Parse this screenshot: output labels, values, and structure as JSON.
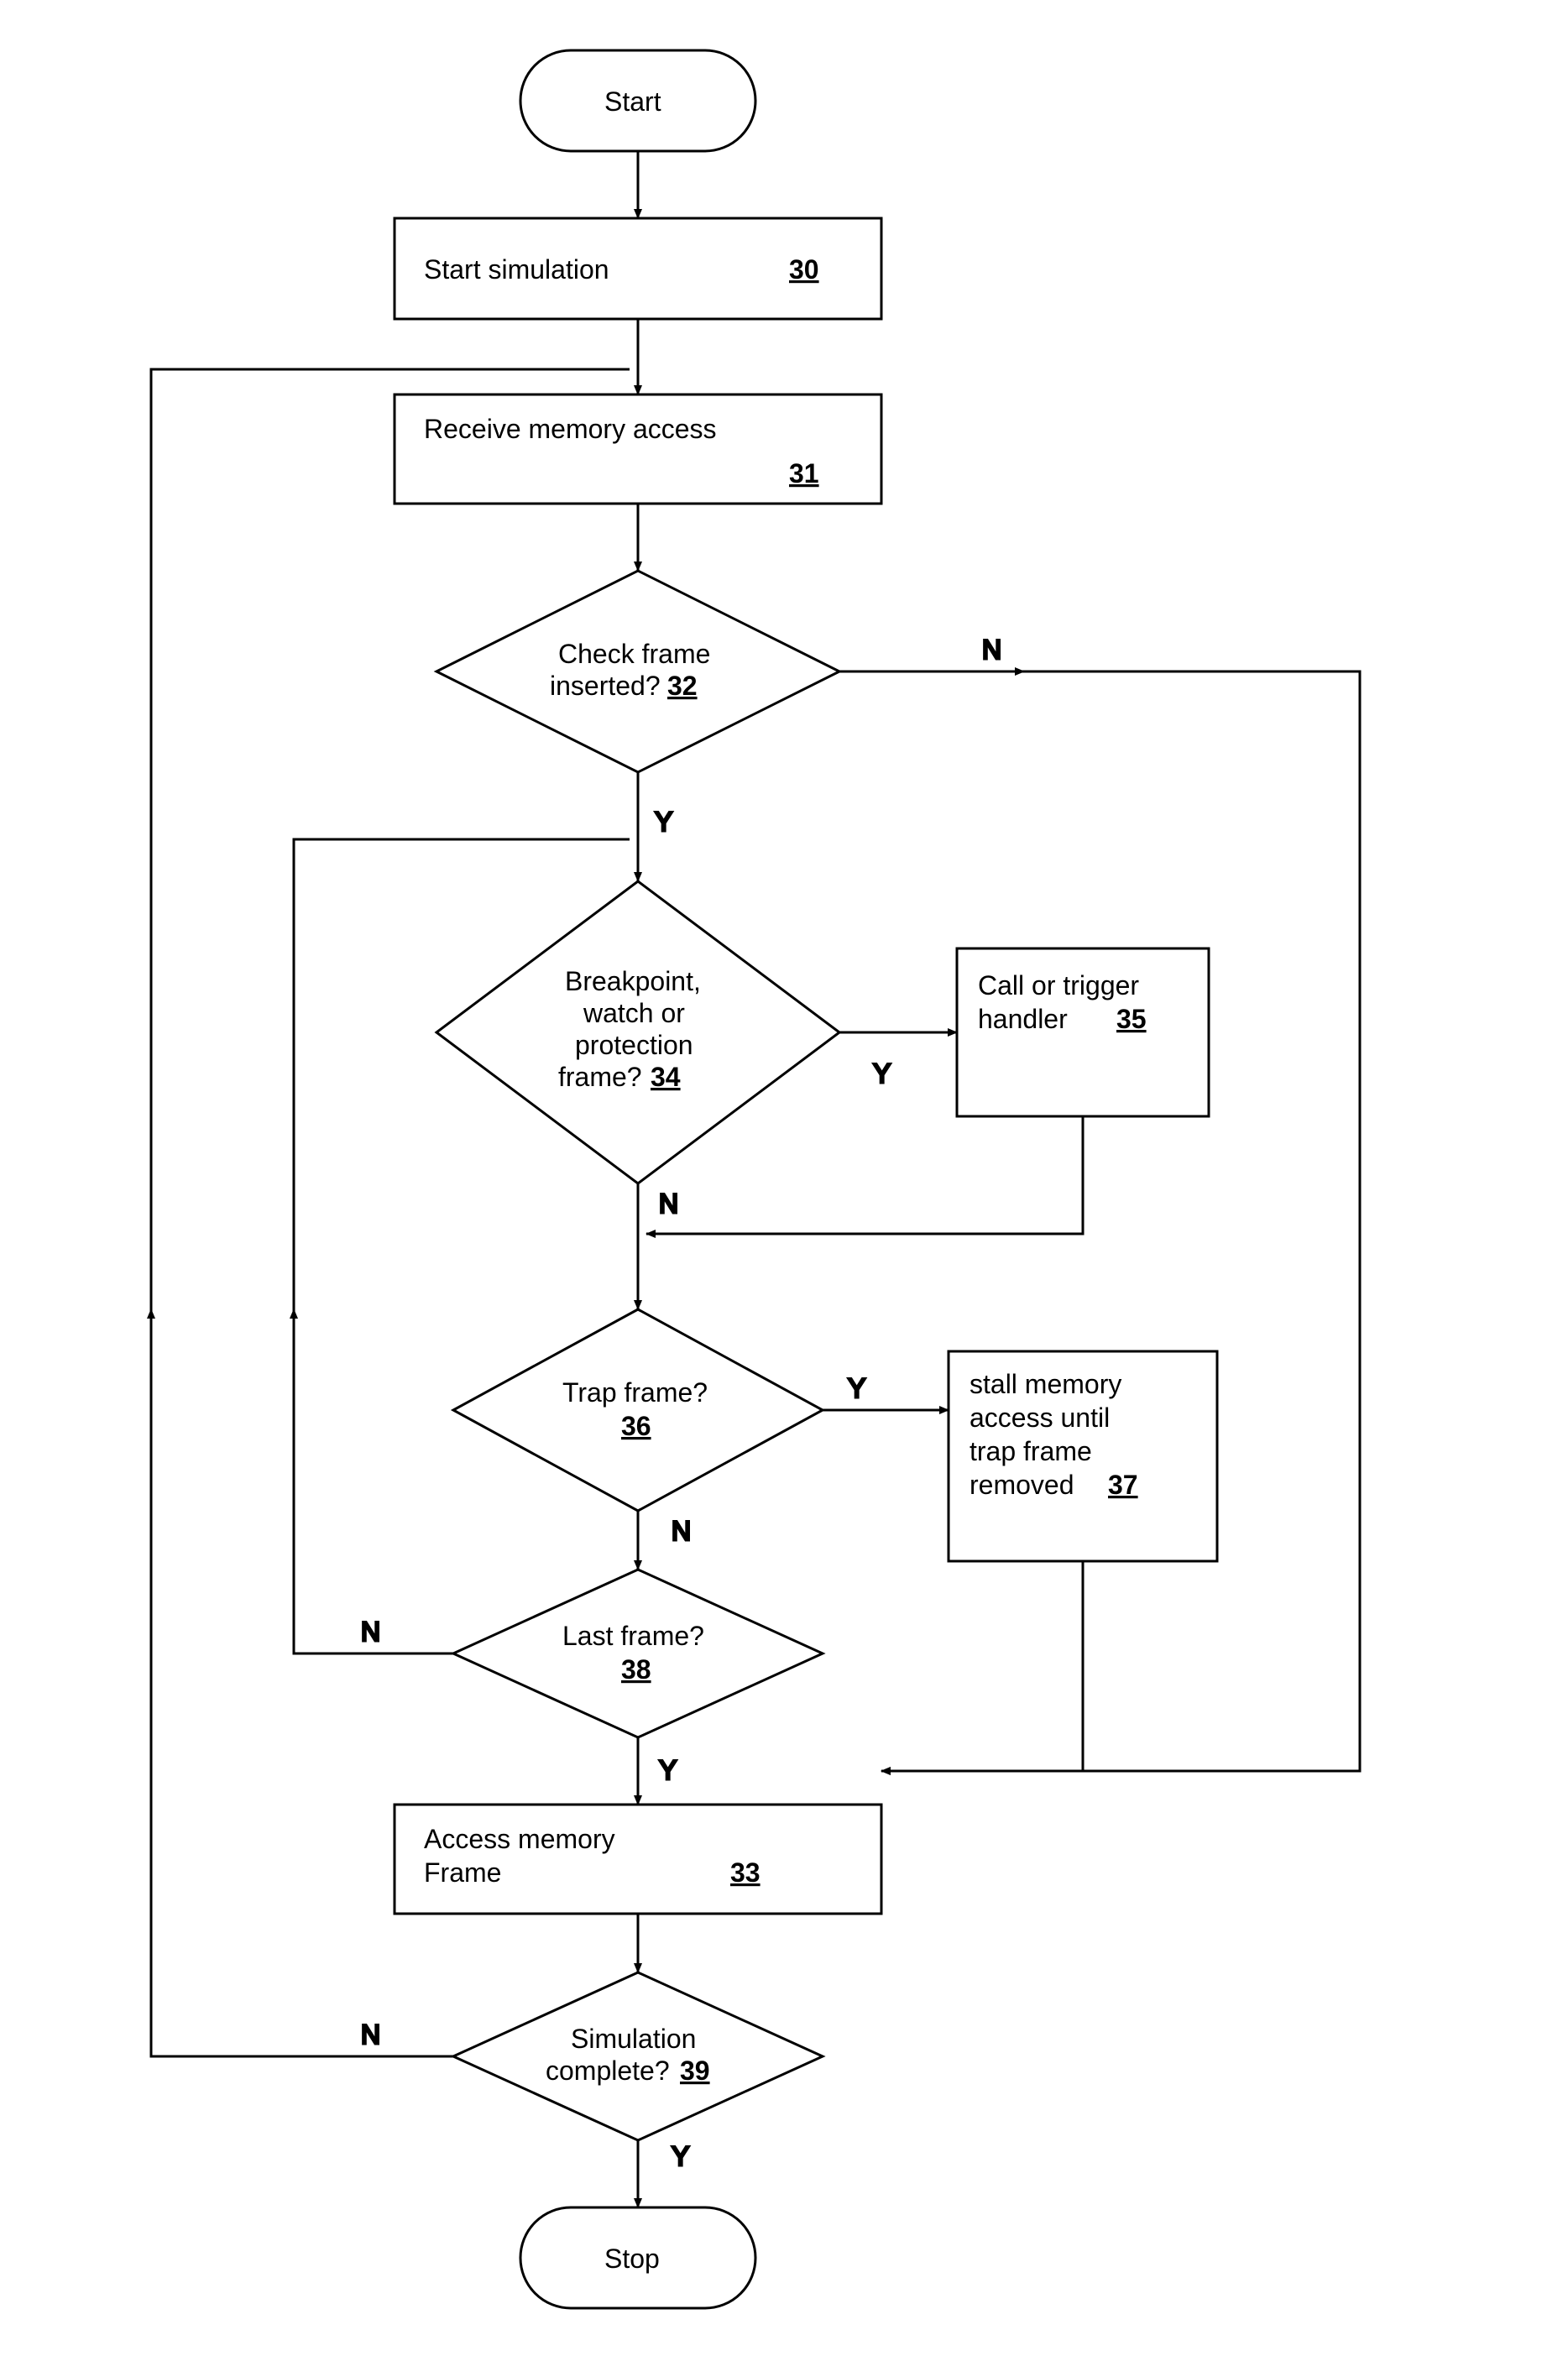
{
  "terminals": {
    "start": "Start",
    "stop": "Stop"
  },
  "processes": {
    "p30": {
      "text": "Start simulation",
      "ref": "30"
    },
    "p31": {
      "text": "Receive memory access",
      "ref": "31"
    },
    "p35": {
      "line1": "Call or trigger",
      "line2": "handler",
      "ref": "35"
    },
    "p37": {
      "line1": "stall memory",
      "line2": "access until",
      "line3": "trap frame",
      "line4": "removed",
      "ref": "37"
    },
    "p33": {
      "line1": "Access memory",
      "line2": "Frame",
      "ref": "33"
    }
  },
  "decisions": {
    "d32": {
      "line1": "Check frame",
      "line2": "inserted?",
      "ref": "32"
    },
    "d34": {
      "line1": "Breakpoint,",
      "line2": "watch or",
      "line3": "protection",
      "line4": "frame?",
      "ref": "34"
    },
    "d36": {
      "line1": "Trap frame?",
      "ref": "36"
    },
    "d38": {
      "line1": "Last frame?",
      "ref": "38"
    },
    "d39": {
      "line1": "Simulation",
      "line2": "complete?",
      "ref": "39"
    }
  },
  "labels": {
    "Y": "Y",
    "N": "N"
  }
}
